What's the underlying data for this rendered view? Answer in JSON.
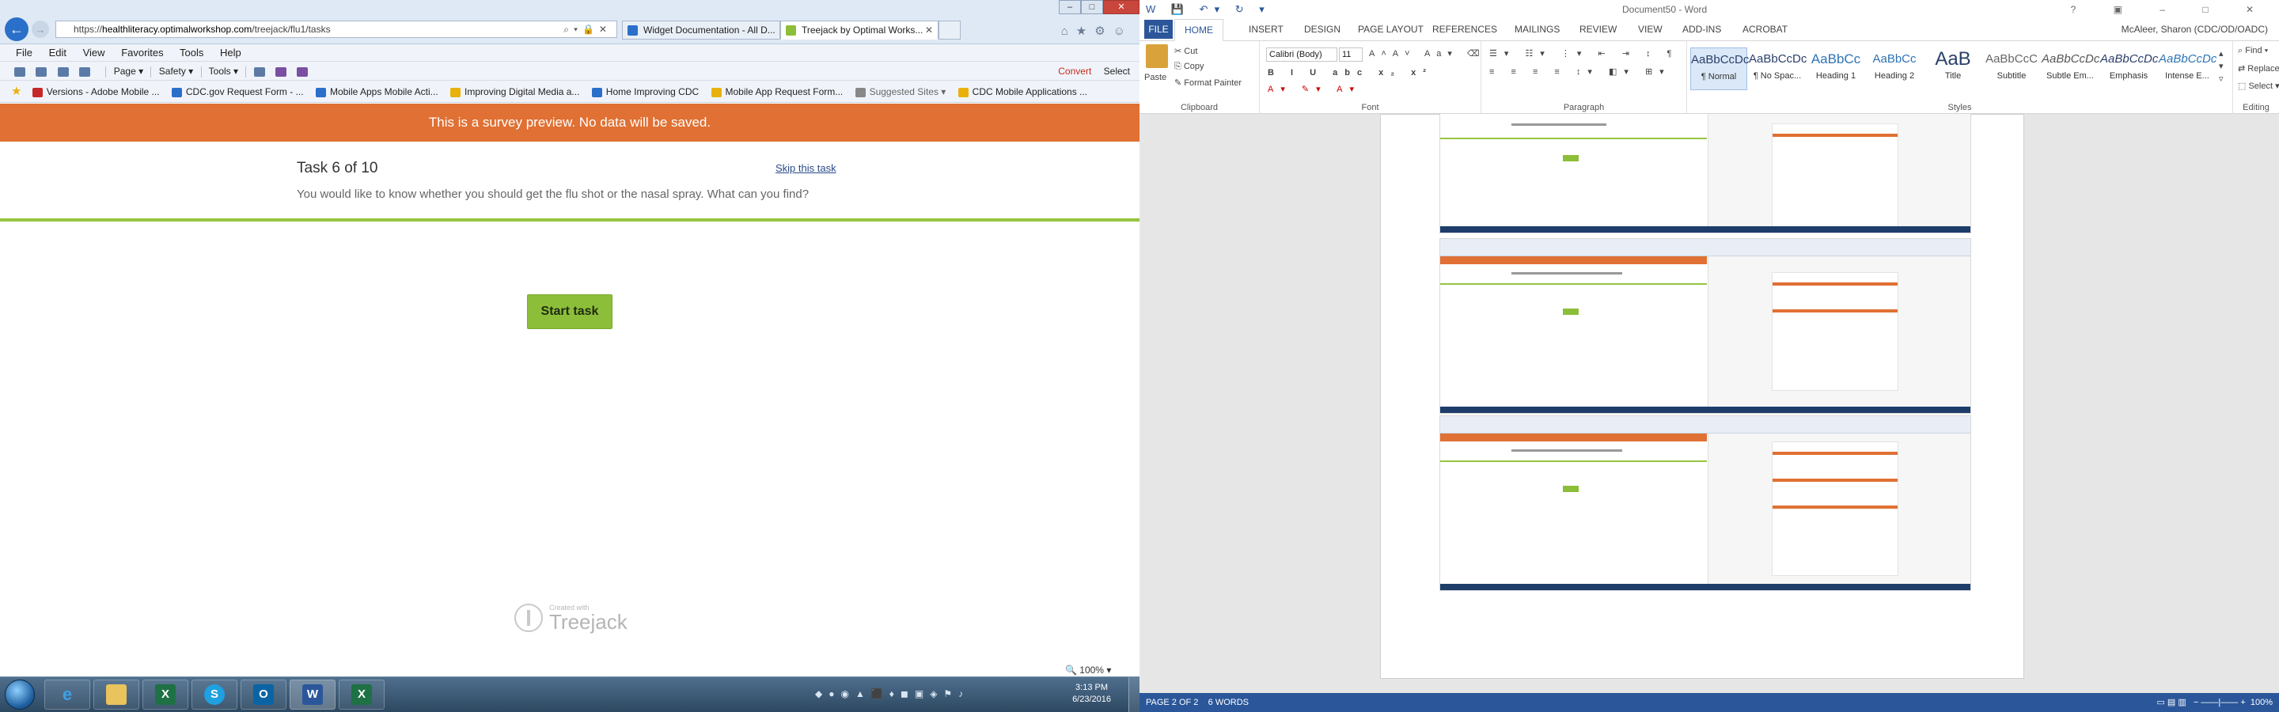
{
  "ie": {
    "url_prefix": "https://",
    "url_domain": "healthliteracy.optimalworkshop.com",
    "url_path": "/treejack/flu1/tasks",
    "tabs": [
      {
        "label": "Widget Documentation - All D..."
      },
      {
        "label": "Treejack by Optimal Works..."
      }
    ],
    "menu": [
      "File",
      "Edit",
      "View",
      "Favorites",
      "Tools",
      "Help"
    ],
    "cmd": {
      "page": "Page ▾",
      "safety": "Safety ▾",
      "tools": "Tools ▾",
      "convert": "Convert",
      "select": "Select"
    },
    "favorites": [
      "Versions - Adobe Mobile ...",
      "CDC.gov Request Form - ...",
      "Mobile Apps  Mobile Acti...",
      "Improving Digital Media a...",
      "Home  Improving CDC",
      "Mobile App Request Form...",
      "Suggested Sites ▾",
      "CDC Mobile Applications ..."
    ],
    "zoom": "100%"
  },
  "survey": {
    "banner": "This is a survey preview. No data will be saved.",
    "task_title": "Task 6 of 10",
    "skip": "Skip this task",
    "description": "You would like to know whether you should get the flu shot or the nasal spray. What can you find?",
    "start": "Start task",
    "created_small": "Created with",
    "created_big": "Treejack"
  },
  "taskbar": {
    "time": "3:13 PM",
    "date": "6/23/2016"
  },
  "word": {
    "title": "Document50 - Word",
    "user": "McAleer, Sharon (CDC/OD/OADC)",
    "tabs": [
      "FILE",
      "HOME",
      "INSERT",
      "DESIGN",
      "PAGE LAYOUT",
      "REFERENCES",
      "MAILINGS",
      "REVIEW",
      "VIEW",
      "ADD-INS",
      "ACROBAT"
    ],
    "clipboard": {
      "paste": "Paste",
      "cut": "Cut",
      "copy": "Copy",
      "format_painter": "Format Painter",
      "label": "Clipboard"
    },
    "font": {
      "name": "Calibri (Body)",
      "size": "11",
      "label": "Font"
    },
    "paragraph_label": "Paragraph",
    "styles": [
      {
        "preview": "AaBbCcDc",
        "name": "¶ Normal"
      },
      {
        "preview": "AaBbCcDc",
        "name": "¶ No Spac..."
      },
      {
        "preview": "AaBbCc",
        "name": "Heading 1"
      },
      {
        "preview": "AaBbCc",
        "name": "Heading 2"
      },
      {
        "preview": "AaB",
        "name": "Title"
      },
      {
        "preview": "AaBbCcC",
        "name": "Subtitle"
      },
      {
        "preview": "AaBbCcDc",
        "name": "Subtle Em..."
      },
      {
        "preview": "AaBbCcDc",
        "name": "Emphasis"
      },
      {
        "preview": "AaBbCcDc",
        "name": "Intense E..."
      }
    ],
    "styles_label": "Styles",
    "editing": {
      "find": "Find ▾",
      "replace": "Replace",
      "select": "Select ▾",
      "label": "Editing"
    },
    "status": {
      "page": "PAGE 2 OF 2",
      "words": "6 WORDS",
      "zoom": "100%"
    }
  }
}
